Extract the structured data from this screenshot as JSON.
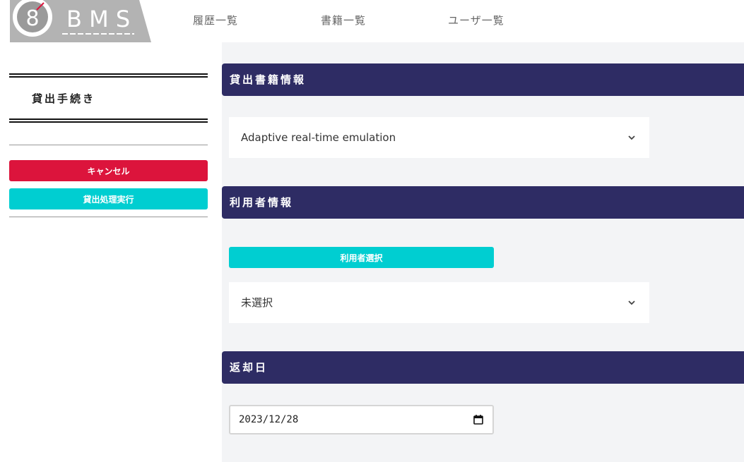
{
  "header": {
    "logo_number": "8",
    "logo_text": "B M S",
    "nav": [
      "履歴一覧",
      "書籍一覧",
      "ユーザ一覧"
    ]
  },
  "sidebar": {
    "title": "貸出手続き",
    "cancel_label": "キャンセル",
    "execute_label": "貸出処理実行"
  },
  "main": {
    "book_section_title": "貸出書籍情報",
    "book_select_value": "Adaptive real-time emulation",
    "user_section_title": "利用者情報",
    "user_select_button": "利用者選択",
    "user_select_value": "未選択",
    "return_section_title": "返却日",
    "return_date_value": "2023/12/28"
  },
  "colors": {
    "navy": "#2e2c64",
    "cancel": "#dc143c",
    "accent": "#00ced1",
    "main_bg": "#f3f4f6"
  },
  "icons": [
    "chevron-down-icon",
    "calendar-icon"
  ]
}
